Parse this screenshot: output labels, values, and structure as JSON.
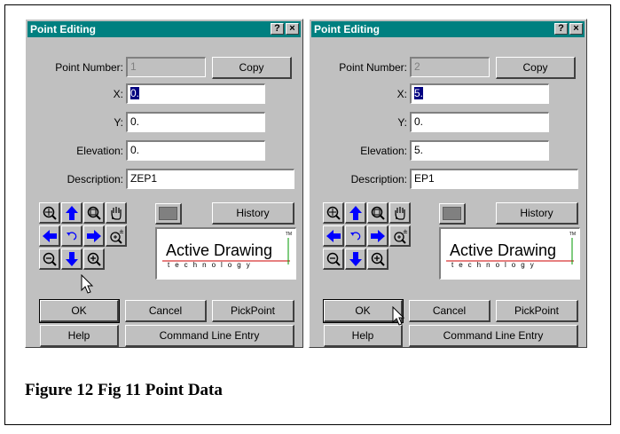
{
  "caption": "Figure 12 Fig 11 Point Data",
  "dialogs": [
    {
      "title": "Point Editing",
      "title_buttons": {
        "help": "?",
        "close": "×"
      },
      "labels": {
        "point_number": "Point Number:",
        "x": "X:",
        "y": "Y:",
        "elevation": "Elevation:",
        "description": "Description:"
      },
      "values": {
        "point_number": "1",
        "x": "0.",
        "y": "0.",
        "elevation": "0.",
        "description": "ZEP1"
      },
      "buttons": {
        "copy": "Copy",
        "history": "History",
        "ok": "OK",
        "cancel": "Cancel",
        "pickpoint": "PickPoint",
        "help": "Help",
        "command_line": "Command Line Entry"
      },
      "logo": {
        "brand": "Active Drawing",
        "sub": "technology",
        "tm": "TM"
      }
    },
    {
      "title": "Point Editing",
      "title_buttons": {
        "help": "?",
        "close": "×"
      },
      "labels": {
        "point_number": "Point Number:",
        "x": "X:",
        "y": "Y:",
        "elevation": "Elevation:",
        "description": "Description:"
      },
      "values": {
        "point_number": "2",
        "x": "5.",
        "y": "0.",
        "elevation": "5.",
        "description": "EP1"
      },
      "buttons": {
        "copy": "Copy",
        "history": "History",
        "ok": "OK",
        "cancel": "Cancel",
        "pickpoint": "PickPoint",
        "help": "Help",
        "command_line": "Command Line Entry"
      },
      "logo": {
        "brand": "Active Drawing",
        "sub": "technology",
        "tm": "TM"
      }
    }
  ],
  "icons": [
    "zoom-extents-icon",
    "pan-up-icon",
    "zoom-window-icon",
    "pan-hand-icon",
    "pan-left-icon",
    "undo-view-icon",
    "pan-right-icon",
    "zoom-previous-icon",
    "zoom-out-icon",
    "pan-down-icon",
    "zoom-in-icon"
  ],
  "colors": {
    "titlebar": "#008080",
    "face": "#c0c0c0",
    "arrow": "#0000ff",
    "selection": "#000080"
  }
}
